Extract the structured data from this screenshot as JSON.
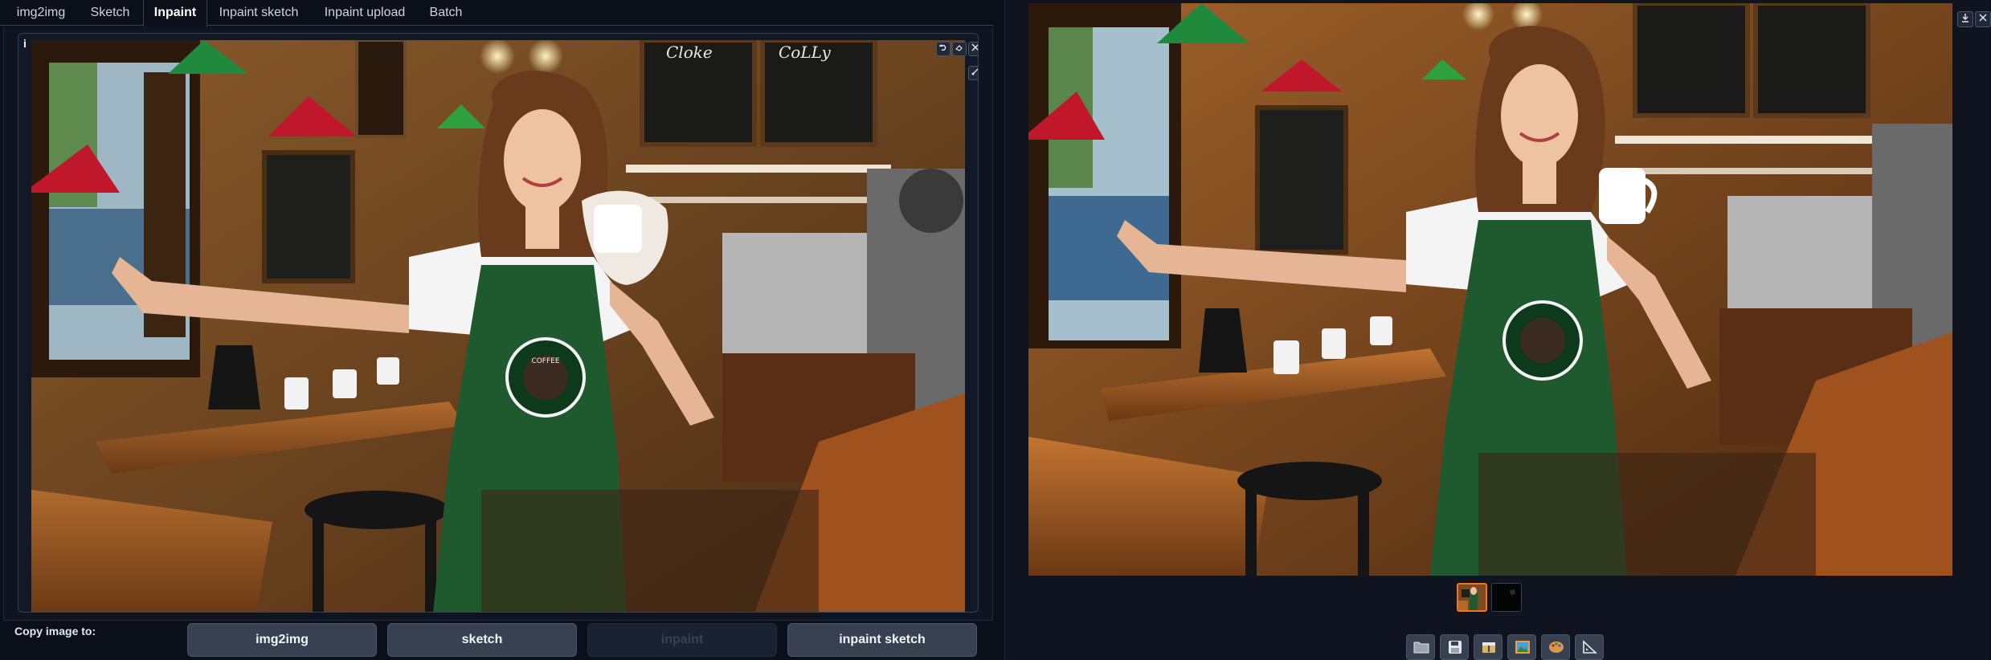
{
  "tabs": [
    {
      "label": "img2img",
      "active": false
    },
    {
      "label": "Sketch",
      "active": false
    },
    {
      "label": "Inpaint",
      "active": true
    },
    {
      "label": "Inpaint sketch",
      "active": false
    },
    {
      "label": "Inpaint upload",
      "active": false
    },
    {
      "label": "Batch",
      "active": false
    }
  ],
  "canvas": {
    "info_label": "i",
    "controls": [
      "undo-icon",
      "erase-icon",
      "close-icon",
      "brush-icon"
    ],
    "signs": {
      "board1": "Cloke",
      "board2": "CoLLy"
    },
    "apron_logo": "COFFEE"
  },
  "copy_bar": {
    "label": "Copy image to:",
    "buttons": [
      {
        "label": "img2img",
        "enabled": true
      },
      {
        "label": "sketch",
        "enabled": true
      },
      {
        "label": "inpaint",
        "enabled": false
      },
      {
        "label": "inpaint sketch",
        "enabled": true
      }
    ]
  },
  "result": {
    "controls": [
      "download-icon",
      "close-icon"
    ],
    "thumbnails": 2,
    "selected_thumbnail": 0,
    "tools": [
      "folder-icon",
      "save-icon",
      "zip-icon",
      "image-icon",
      "palette-icon",
      "ruler-icon"
    ]
  },
  "colors": {
    "accent": "#f97316",
    "background": "#0b0f19",
    "button": "#374151"
  }
}
